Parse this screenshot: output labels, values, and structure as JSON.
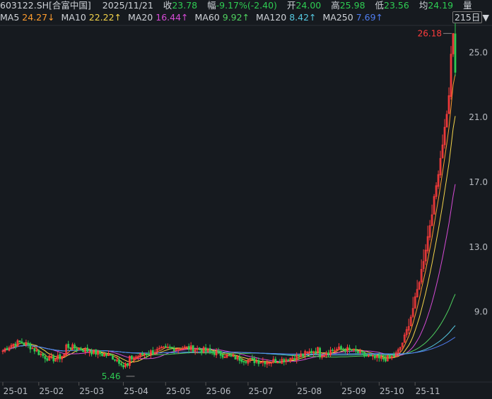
{
  "header": {
    "symbol": "603122.SH[合富中国]",
    "date": "2025/11/21",
    "close_label": "收",
    "close_value": "23.78",
    "amp_label": "幅",
    "amp_value": "-9.17%(-2.40)",
    "open_label": "开",
    "open_value": "24.00",
    "high_label": "高",
    "high_value": "25.98",
    "low_label": "低",
    "low_value": "23.56",
    "avg_label": "均",
    "avg_value": "24.19",
    "vol_label": "量"
  },
  "ma_legend": [
    {
      "label": "MA5",
      "value": "24.27↓",
      "color": "#ff9d2e"
    },
    {
      "label": "MA10",
      "value": "22.22↑",
      "color": "#f4d44a"
    },
    {
      "label": "MA20",
      "value": "16.44↑",
      "color": "#d64bd6"
    },
    {
      "label": "MA60",
      "value": "9.92↑",
      "color": "#4fd15f"
    },
    {
      "label": "MA120",
      "value": "8.42↑",
      "color": "#55c8e0"
    },
    {
      "label": "MA250",
      "value": "7.69↑",
      "color": "#4f7df0"
    }
  ],
  "range_badge": "215日",
  "range_arrow": "▼",
  "chart_data": {
    "type": "candlestick",
    "x_ticks": [
      "25-01",
      "25-02",
      "25-03",
      "25-04",
      "25-05",
      "25-06",
      "25-07",
      "25-08",
      "25-09",
      "25-10",
      "25-11"
    ],
    "y_ticks": [
      "25.0",
      "21.0",
      "17.0",
      "13.0",
      "9.0"
    ],
    "ylim": [
      4.8,
      26.5
    ],
    "max_annotation": "26.18",
    "min_annotation": "5.46",
    "max_value": 26.18,
    "min_value": 5.46,
    "last_close": 23.78,
    "colors": {
      "up": "#ff3c3c",
      "down": "#2ecc52",
      "grid": "#2a2f36"
    }
  }
}
